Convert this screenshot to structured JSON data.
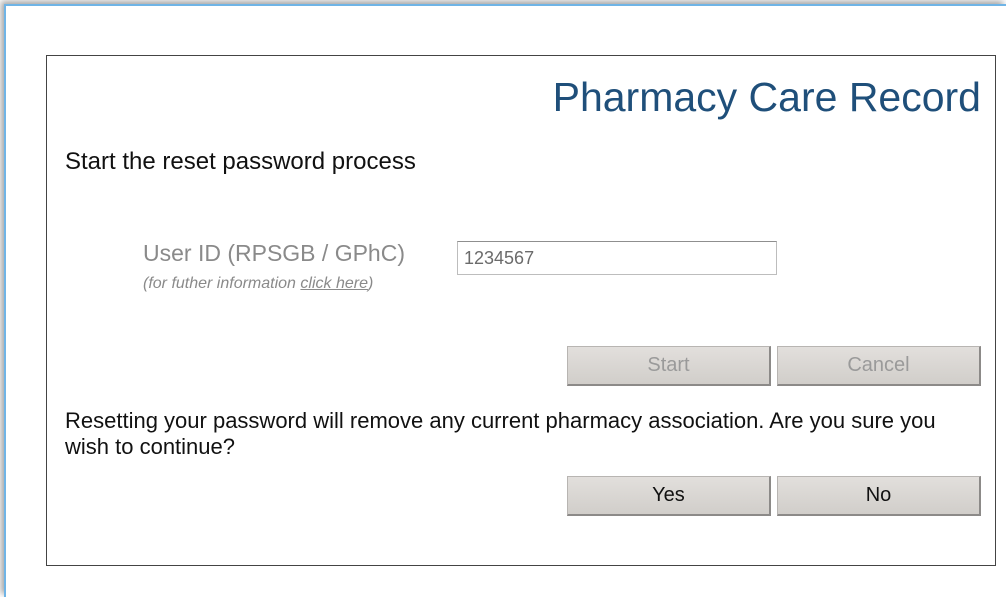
{
  "header": {
    "title": "Pharmacy Care Record"
  },
  "form": {
    "heading": "Start the reset password process",
    "user_id_label": "User ID (RPSGB / GPhC)",
    "help_prefix": "(for futher information ",
    "help_link": "click here",
    "help_suffix": ")",
    "user_id_value": "1234567"
  },
  "buttons": {
    "start": "Start",
    "cancel": "Cancel",
    "yes": "Yes",
    "no": "No"
  },
  "confirm": {
    "message": "Resetting your password will remove any current pharmacy association. Are you sure you wish to continue?"
  },
  "colors": {
    "title": "#1f4f7a",
    "frame_border": "#6fb4e6",
    "button_face": "#d9d6d3",
    "disabled_text": "#9a9a9a"
  }
}
